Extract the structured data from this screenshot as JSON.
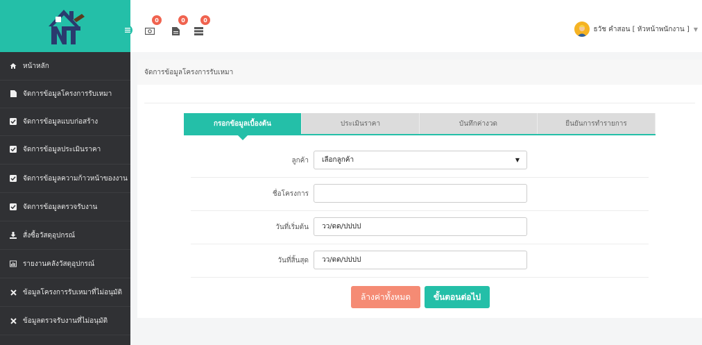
{
  "sidebar": {
    "items": [
      {
        "label": "หน้าหลัก",
        "icon": "home-icon"
      },
      {
        "label": "จัดการข้อมูลโครงการรับเหมา",
        "icon": "file-icon"
      },
      {
        "label": "จัดการข้อมูลแบบก่อสร้าง",
        "icon": "checkbox-icon"
      },
      {
        "label": "จัดการข้อมูลประเมินราคา",
        "icon": "checkbox-icon"
      },
      {
        "label": "จัดการข้อมูลความก้าวหน้าของงาน",
        "icon": "checkbox-icon"
      },
      {
        "label": "จัดการข้อมูลตรวจรับงาน",
        "icon": "checkbox-icon"
      },
      {
        "label": "สั่งซื้อวัสดุอุปกรณ์",
        "icon": "download-icon"
      },
      {
        "label": "รายงานคลังวัสดุอุปกรณ์",
        "icon": "chart-icon"
      },
      {
        "label": "ข้อมูลโครงการรับเหมาที่ไม่อนุมัติ",
        "icon": "x-icon"
      },
      {
        "label": "ข้อมูลตรวจรับงานที่ไม่อนุมัติ",
        "icon": "x-icon"
      }
    ]
  },
  "topbar": {
    "badges": [
      "0",
      "0",
      "0"
    ],
    "user_label": "ธวัช คำสอน [ หัวหน้าพนักงาน ]"
  },
  "breadcrumb": "จัดการข้อมูลโครงการรับเหมา",
  "tabs": [
    {
      "label": "กรอกข้อมูลเบื้องต้น"
    },
    {
      "label": "ประเมินราคา"
    },
    {
      "label": "บันทึกค่างวด"
    },
    {
      "label": "ยืนยันการทำรายการ"
    }
  ],
  "form": {
    "customer_label": "ลูกค้า",
    "customer_value": "เลือกลูกค้า",
    "project_label": "ชื่อโครงการ",
    "project_value": "",
    "start_label": "วันที่เริ่มต้น",
    "start_value": "วว/ดด/ปปปป",
    "end_label": "วันที่สิ้นสุด",
    "end_value": "วว/ดด/ปปปป"
  },
  "buttons": {
    "clear": "ล้างค่าทั้งหมด",
    "next": "ขั้นตอนต่อไป"
  },
  "colors": {
    "accent": "#24bfa8",
    "sidebar": "#303134",
    "badge": "#f0634f",
    "clear_button": "#f58b74"
  }
}
